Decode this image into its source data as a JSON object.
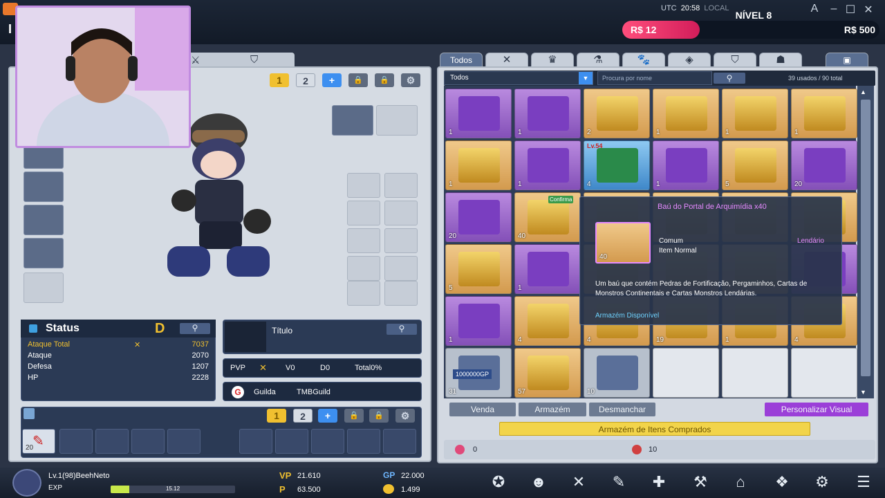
{
  "topbar": {
    "utc_label": "UTC",
    "time": "20:58",
    "local_label": "LOCAL",
    "level_label": "NÍVEL 8",
    "cash_left": "R$ 12",
    "cash_right": "R$ 500",
    "title_initial": "I"
  },
  "left": {
    "page_1": "1",
    "page_2": "2",
    "status_title": "Status",
    "rank": "D",
    "stats": [
      {
        "label": "Ataque Total",
        "value": "7037"
      },
      {
        "label": "Ataque",
        "value": "2070"
      },
      {
        "label": "Defesa",
        "value": "1207"
      },
      {
        "label": "HP",
        "value": "2228"
      }
    ],
    "title_label": "Título",
    "pvp": {
      "label": "PVP",
      "v": "V0",
      "d": "D0",
      "total": "Total0%"
    },
    "guild": {
      "label": "Guilda",
      "name": "TMBGuild"
    },
    "hotbar_page_1": "1",
    "hotbar_page_2": "2",
    "hotbar_count": "20"
  },
  "inventory": {
    "tab_all": "Todos",
    "filter_value": "Todos",
    "search_placeholder": "Procura por nome",
    "usage": "39 usados / 90 total",
    "cells": [
      {
        "count": "1",
        "color": "purple"
      },
      {
        "count": "1",
        "color": "purple"
      },
      {
        "count": "2",
        "color": "orange"
      },
      {
        "count": "1",
        "color": "orange"
      },
      {
        "count": "1",
        "color": "orange"
      },
      {
        "count": "1",
        "color": "orange"
      },
      {
        "count": "1",
        "color": "orange"
      },
      {
        "count": "1",
        "color": "purple"
      },
      {
        "count": "4",
        "color": "blue",
        "level": "Lv.54"
      },
      {
        "count": "1",
        "color": "purple"
      },
      {
        "count": "5",
        "color": "orange"
      },
      {
        "count": "20",
        "color": "purple"
      },
      {
        "count": "20",
        "color": "purple"
      },
      {
        "count": "40",
        "color": "orange",
        "confirm": "Confirma"
      },
      {
        "count": "",
        "color": "orange"
      },
      {
        "count": "",
        "color": "orange"
      },
      {
        "count": "",
        "color": "orange"
      },
      {
        "count": "",
        "color": "orange"
      },
      {
        "count": "5",
        "color": "orange"
      },
      {
        "count": "1",
        "color": "purple"
      },
      {
        "count": "",
        "color": "orange"
      },
      {
        "count": "",
        "color": "orange"
      },
      {
        "count": "",
        "color": "orange"
      },
      {
        "count": "",
        "color": "purple"
      },
      {
        "count": "1",
        "color": "purple"
      },
      {
        "count": "4",
        "color": "orange"
      },
      {
        "count": "4",
        "color": "orange"
      },
      {
        "count": "19",
        "color": "orange"
      },
      {
        "count": "1",
        "color": "orange"
      },
      {
        "count": "4",
        "color": "orange"
      },
      {
        "count": "31",
        "color": "gray"
      },
      {
        "count": "57",
        "color": "orange"
      },
      {
        "count": "10",
        "color": "gray"
      },
      {
        "count": "",
        "color": "empty"
      },
      {
        "count": "",
        "color": "empty"
      },
      {
        "count": "",
        "color": "empty"
      }
    ],
    "gp_text": "1000000GP",
    "tooltip": {
      "title": "Baú do Portal de Arquimídia x40",
      "count": "40",
      "grade": "Comum",
      "type": "Item Normal",
      "rarity": "Lendário",
      "desc_1": "Um baú que contém Pedras de Fortificação, Pergaminhos, Cartas de",
      "desc_2": "Monstros Continentais e Cartas Monstros Lendárias.",
      "storage": "Armazém Disponível"
    },
    "buttons": {
      "sell": "Venda",
      "storage": "Armazém",
      "disassemble": "Desmanchar",
      "customize": "Personalizar Visual",
      "purchased": "Armazém de Itens Comprados"
    },
    "currency_left": "0",
    "currency_right": "10"
  },
  "bottom": {
    "player": "Lv.1(98)BeehNeto",
    "exp_label": "EXP",
    "exp_pct": "15.12",
    "exp_fill": 0.15,
    "vp_label": "VP",
    "vp": "21.610",
    "p_value": "63.500",
    "gp_label": "GP",
    "gp": "22.000",
    "coin": "1.499"
  },
  "colors": {
    "accent": "#f0c030",
    "brand": "#ff4e7c",
    "purple": "#9b5fd0"
  }
}
